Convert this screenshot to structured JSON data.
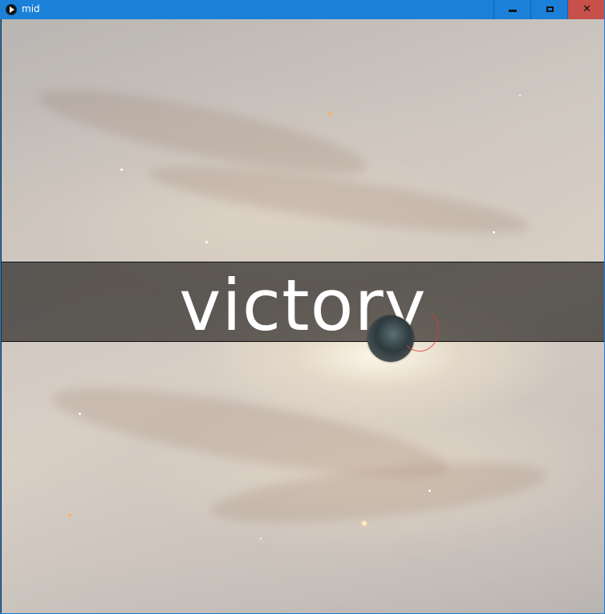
{
  "window": {
    "title": "mid",
    "minimize_icon": "minimize-icon",
    "maximize_icon": "maximize-icon",
    "close_icon": "close-icon",
    "close_glyph": "✕",
    "app_icon": "play-icon"
  },
  "game": {
    "background": "spiral-galaxy",
    "banner_text": "victory",
    "player_sprite": "orb"
  },
  "colors": {
    "titlebar": "#1b80d8",
    "close_button": "#c7504a",
    "banner_text": "#ffffff"
  }
}
